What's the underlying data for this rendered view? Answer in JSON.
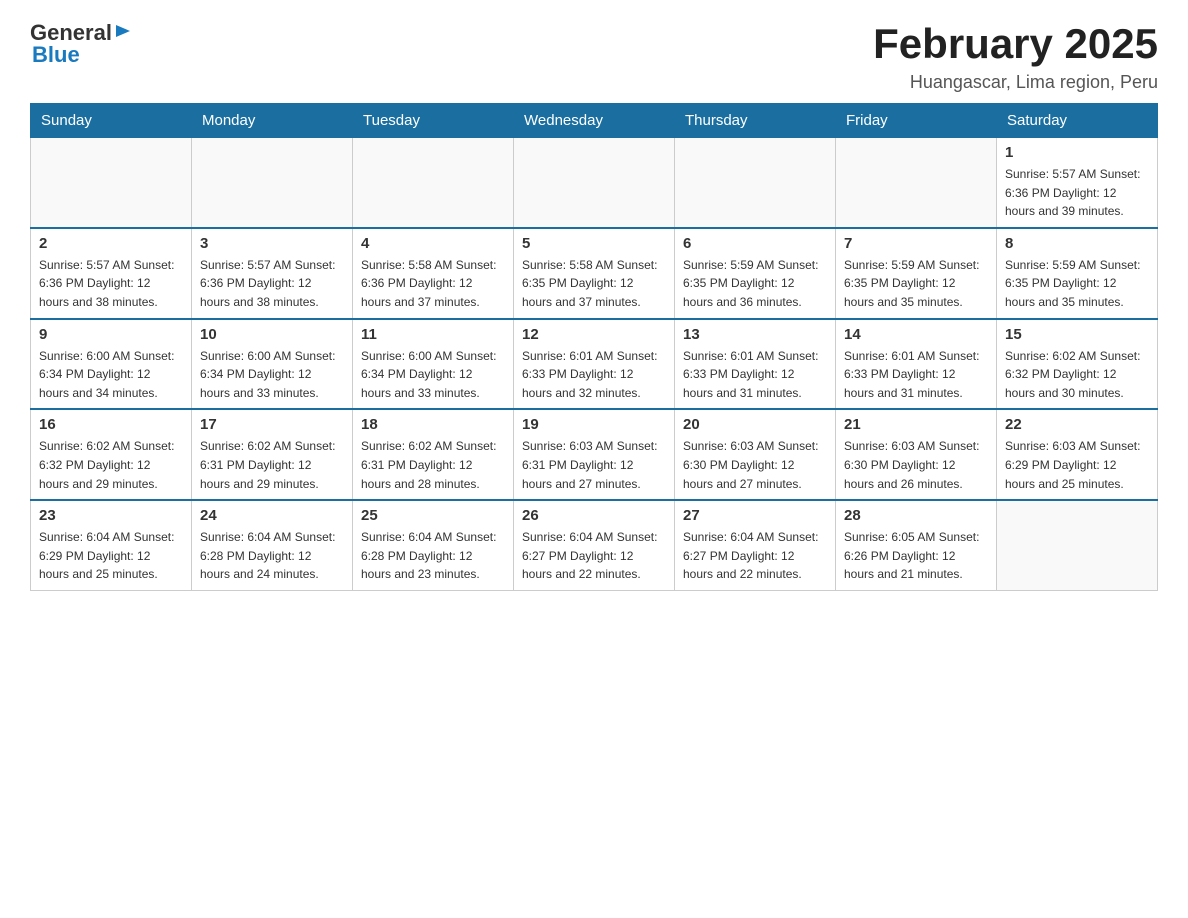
{
  "header": {
    "logo_general": "General",
    "logo_blue": "Blue",
    "title": "February 2025",
    "subtitle": "Huangascar, Lima region, Peru"
  },
  "days_of_week": [
    "Sunday",
    "Monday",
    "Tuesday",
    "Wednesday",
    "Thursday",
    "Friday",
    "Saturday"
  ],
  "weeks": [
    [
      {
        "day": "",
        "info": ""
      },
      {
        "day": "",
        "info": ""
      },
      {
        "day": "",
        "info": ""
      },
      {
        "day": "",
        "info": ""
      },
      {
        "day": "",
        "info": ""
      },
      {
        "day": "",
        "info": ""
      },
      {
        "day": "1",
        "info": "Sunrise: 5:57 AM\nSunset: 6:36 PM\nDaylight: 12 hours\nand 39 minutes."
      }
    ],
    [
      {
        "day": "2",
        "info": "Sunrise: 5:57 AM\nSunset: 6:36 PM\nDaylight: 12 hours\nand 38 minutes."
      },
      {
        "day": "3",
        "info": "Sunrise: 5:57 AM\nSunset: 6:36 PM\nDaylight: 12 hours\nand 38 minutes."
      },
      {
        "day": "4",
        "info": "Sunrise: 5:58 AM\nSunset: 6:36 PM\nDaylight: 12 hours\nand 37 minutes."
      },
      {
        "day": "5",
        "info": "Sunrise: 5:58 AM\nSunset: 6:35 PM\nDaylight: 12 hours\nand 37 minutes."
      },
      {
        "day": "6",
        "info": "Sunrise: 5:59 AM\nSunset: 6:35 PM\nDaylight: 12 hours\nand 36 minutes."
      },
      {
        "day": "7",
        "info": "Sunrise: 5:59 AM\nSunset: 6:35 PM\nDaylight: 12 hours\nand 35 minutes."
      },
      {
        "day": "8",
        "info": "Sunrise: 5:59 AM\nSunset: 6:35 PM\nDaylight: 12 hours\nand 35 minutes."
      }
    ],
    [
      {
        "day": "9",
        "info": "Sunrise: 6:00 AM\nSunset: 6:34 PM\nDaylight: 12 hours\nand 34 minutes."
      },
      {
        "day": "10",
        "info": "Sunrise: 6:00 AM\nSunset: 6:34 PM\nDaylight: 12 hours\nand 33 minutes."
      },
      {
        "day": "11",
        "info": "Sunrise: 6:00 AM\nSunset: 6:34 PM\nDaylight: 12 hours\nand 33 minutes."
      },
      {
        "day": "12",
        "info": "Sunrise: 6:01 AM\nSunset: 6:33 PM\nDaylight: 12 hours\nand 32 minutes."
      },
      {
        "day": "13",
        "info": "Sunrise: 6:01 AM\nSunset: 6:33 PM\nDaylight: 12 hours\nand 31 minutes."
      },
      {
        "day": "14",
        "info": "Sunrise: 6:01 AM\nSunset: 6:33 PM\nDaylight: 12 hours\nand 31 minutes."
      },
      {
        "day": "15",
        "info": "Sunrise: 6:02 AM\nSunset: 6:32 PM\nDaylight: 12 hours\nand 30 minutes."
      }
    ],
    [
      {
        "day": "16",
        "info": "Sunrise: 6:02 AM\nSunset: 6:32 PM\nDaylight: 12 hours\nand 29 minutes."
      },
      {
        "day": "17",
        "info": "Sunrise: 6:02 AM\nSunset: 6:31 PM\nDaylight: 12 hours\nand 29 minutes."
      },
      {
        "day": "18",
        "info": "Sunrise: 6:02 AM\nSunset: 6:31 PM\nDaylight: 12 hours\nand 28 minutes."
      },
      {
        "day": "19",
        "info": "Sunrise: 6:03 AM\nSunset: 6:31 PM\nDaylight: 12 hours\nand 27 minutes."
      },
      {
        "day": "20",
        "info": "Sunrise: 6:03 AM\nSunset: 6:30 PM\nDaylight: 12 hours\nand 27 minutes."
      },
      {
        "day": "21",
        "info": "Sunrise: 6:03 AM\nSunset: 6:30 PM\nDaylight: 12 hours\nand 26 minutes."
      },
      {
        "day": "22",
        "info": "Sunrise: 6:03 AM\nSunset: 6:29 PM\nDaylight: 12 hours\nand 25 minutes."
      }
    ],
    [
      {
        "day": "23",
        "info": "Sunrise: 6:04 AM\nSunset: 6:29 PM\nDaylight: 12 hours\nand 25 minutes."
      },
      {
        "day": "24",
        "info": "Sunrise: 6:04 AM\nSunset: 6:28 PM\nDaylight: 12 hours\nand 24 minutes."
      },
      {
        "day": "25",
        "info": "Sunrise: 6:04 AM\nSunset: 6:28 PM\nDaylight: 12 hours\nand 23 minutes."
      },
      {
        "day": "26",
        "info": "Sunrise: 6:04 AM\nSunset: 6:27 PM\nDaylight: 12 hours\nand 22 minutes."
      },
      {
        "day": "27",
        "info": "Sunrise: 6:04 AM\nSunset: 6:27 PM\nDaylight: 12 hours\nand 22 minutes."
      },
      {
        "day": "28",
        "info": "Sunrise: 6:05 AM\nSunset: 6:26 PM\nDaylight: 12 hours\nand 21 minutes."
      },
      {
        "day": "",
        "info": ""
      }
    ]
  ]
}
